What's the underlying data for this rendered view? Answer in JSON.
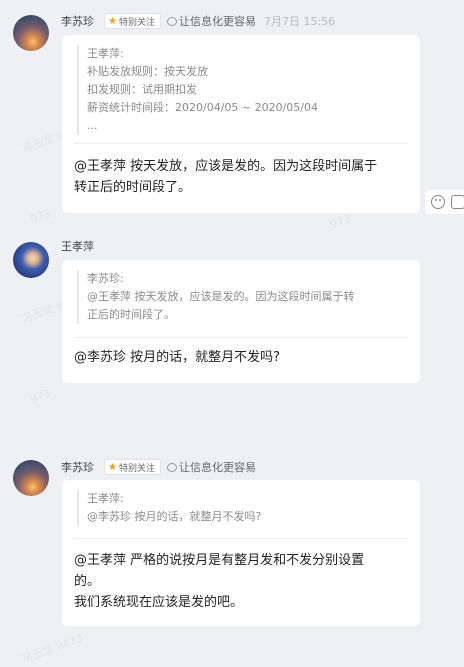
{
  "watermarks": [
    "冯玉龙 9473",
    "973",
    "冯玉龙 9473",
    "973",
    "冯玉龙 9473",
    "973"
  ],
  "messages": [
    {
      "sender": "李苏珍",
      "tag_label": "特别关注",
      "signature": "让信息化更容易",
      "time": "7月7日 15:56",
      "quote_lines": [
        "王孝萍:",
        "补贴发放规则：按天发放",
        "扣发规则：试用期扣发",
        "薪资统计时间段：2020/04/05 ~ 2020/05/04",
        "..."
      ],
      "body_lines": [
        "@王孝萍  按天发放，应该是发的。因为这段时间属于",
        "转正后的时间段了。"
      ]
    },
    {
      "sender": "王孝萍",
      "quote_lines": [
        "李苏珍:",
        "@王孝萍  按天发放，应该是发的。因为这段时间属于转",
        "正后的时间段了。"
      ],
      "body_lines": [
        "@李苏珍 按月的话，就整月不发吗?"
      ]
    },
    {
      "sender": "李苏珍",
      "tag_label": "特别关注",
      "signature": "让信息化更容易",
      "quote_lines": [
        "王孝萍:",
        "@李苏珍 按月的话，就整月不发吗?"
      ],
      "body_lines": [
        "@王孝萍  严格的说按月是有整月发和不发分别设置",
        "的。",
        "我们系统现在应该是发的吧。"
      ]
    }
  ],
  "colors": {
    "background": "#eef0f3",
    "bubble": "#ffffff",
    "star": "#f2a20d"
  },
  "icons": {
    "tag": "star-icon",
    "signature": "speech-bubble-icon",
    "actions": [
      "emoji-icon",
      "reply-icon"
    ]
  }
}
